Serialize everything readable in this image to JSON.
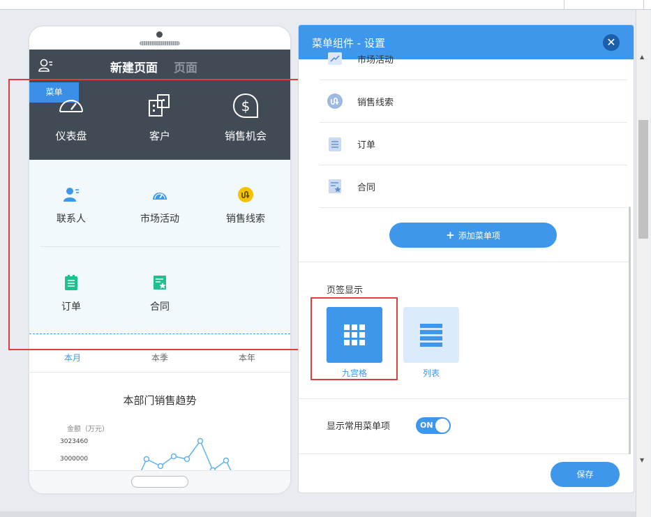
{
  "phone": {
    "header_title": "新建页面",
    "header_title_secondary": "页面",
    "menu_tag": "菜单",
    "big_items": [
      {
        "label": "仪表盘",
        "icon": "dashboard-icon"
      },
      {
        "label": "客户",
        "icon": "building-icon"
      },
      {
        "label": "销售机会",
        "icon": "dollar-icon"
      }
    ],
    "small_items": [
      {
        "label": "联系人",
        "icon": "contact-icon",
        "color": "#3f97ec"
      },
      {
        "label": "市场活动",
        "icon": "gauge-icon",
        "color": "#3f97ec"
      },
      {
        "label": "销售线索",
        "icon": "lead-icon",
        "color": "#f5c200"
      },
      {
        "label": "订单",
        "icon": "order-icon",
        "color": "#1fbf8f"
      },
      {
        "label": "合同",
        "icon": "contract-icon",
        "color": "#1fbf8f"
      }
    ],
    "periods": [
      "本月",
      "本季",
      "本年"
    ],
    "active_period": "本月",
    "chart_title": "本部门销售趋势",
    "chart_unit": "金额（万元）",
    "chart_ticks": [
      "3023460",
      "3000000"
    ]
  },
  "panel": {
    "title": "菜单组件 - 设置",
    "menu_rows": [
      {
        "label": "市场活动",
        "icon": "campaign-icon"
      },
      {
        "label": "销售线索",
        "icon": "lead-icon"
      },
      {
        "label": "订单",
        "icon": "order-icon"
      },
      {
        "label": "合同",
        "icon": "contract-icon"
      }
    ],
    "add_button": "添加菜单项",
    "tab_display_label": "页签显示",
    "layout_options": [
      {
        "label": "九宫格",
        "selected": true
      },
      {
        "label": "列表",
        "selected": false
      }
    ],
    "show_common_label": "显示常用菜单项",
    "toggle_state": "ON",
    "save_button": "保存"
  },
  "colors": {
    "accent": "#3f97ec",
    "dark_header": "#404b55",
    "highlight": "#e03d3d"
  }
}
